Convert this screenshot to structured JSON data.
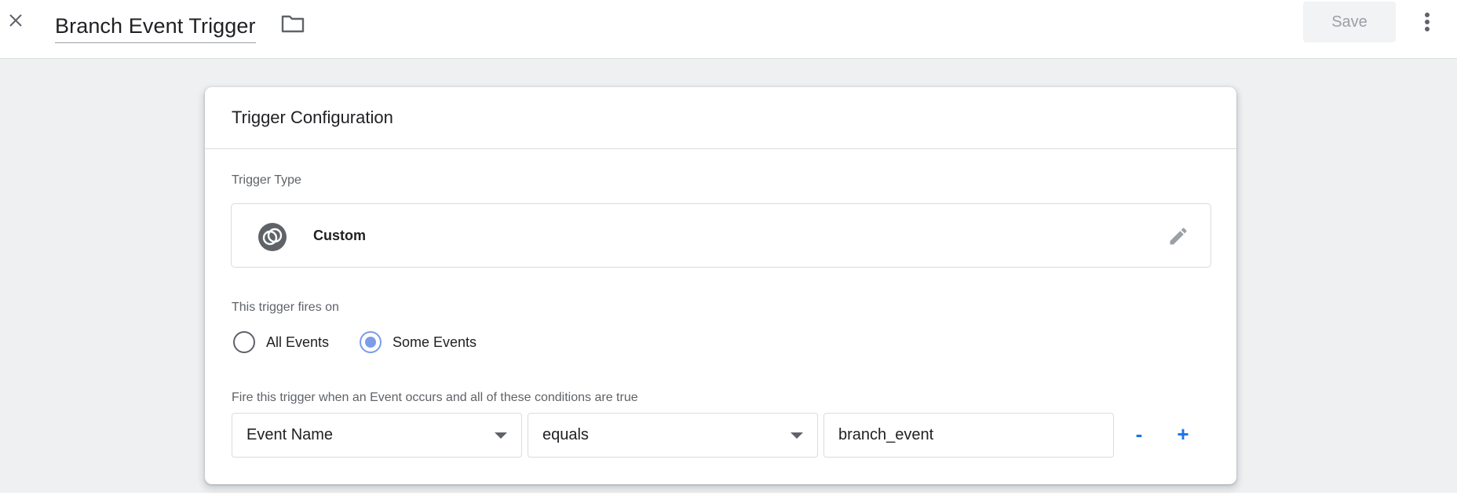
{
  "header": {
    "title": "Branch Event Trigger",
    "save_label": "Save",
    "icons": {
      "close": "close-icon",
      "folder": "folder-icon",
      "more": "more-vert-icon"
    }
  },
  "card": {
    "title": "Trigger Configuration",
    "trigger_type_label": "Trigger Type",
    "trigger_type": {
      "name": "Custom",
      "icon": "custom-event-icon",
      "edit_icon": "pencil-icon"
    },
    "fires_on_label": "This trigger fires on",
    "fires_on_options": [
      {
        "label": "All Events",
        "selected": false
      },
      {
        "label": "Some Events",
        "selected": true
      }
    ],
    "conditions_label": "Fire this trigger when an Event occurs and all of these conditions are true",
    "condition": {
      "variable": "Event Name",
      "operator": "equals",
      "value": "branch_event",
      "remove_label": "-",
      "add_label": "+"
    }
  },
  "colors": {
    "accent": "#1a73e8",
    "radio_selected": "#7b9ce8",
    "background": "#eef0f2",
    "icon_gray": "#5f6368"
  }
}
